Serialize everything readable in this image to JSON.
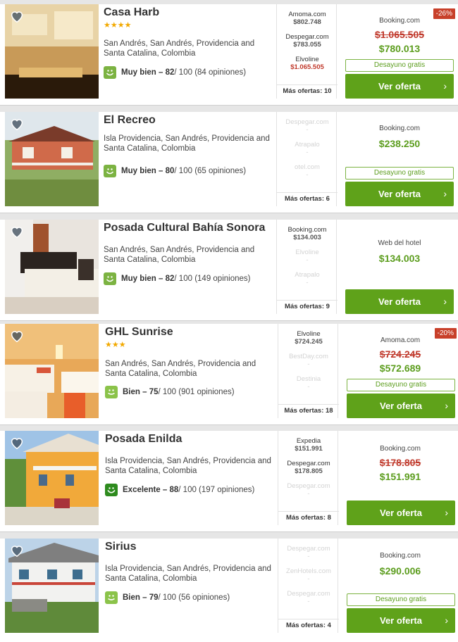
{
  "hotels": [
    {
      "name": "Casa Harb",
      "stars": "★★★★",
      "address": "San Andrés, San Andrés, Providencia and Santa Catalina, Colombia",
      "rating_label": "Muy bien – 82",
      "rating_rest": " / 100 (84 opiniones)",
      "rating_color": "#7cb342",
      "offers": [
        {
          "site": "Amoma.com",
          "price": "$802.748"
        },
        {
          "site": "Despegar.com",
          "price": "$783.055"
        },
        {
          "site": "Elvoline",
          "price": "$1.065.505"
        }
      ],
      "more_offers": "Más ofertas: 10",
      "discount": "-26%",
      "provider": "Booking.com",
      "old_price": "$1.065.505",
      "price": "$780.013",
      "breakfast": "Desayuno gratis",
      "button": "Ver oferta"
    },
    {
      "name": "El Recreo",
      "address": "Isla Providencia, San Andrés, Providencia and Santa Catalina, Colombia",
      "rating_label": "Muy bien – 80",
      "rating_rest": " / 100 (65 opiniones)",
      "rating_color": "#7cb342",
      "offers": [
        {
          "site": "Despegar.com",
          "price": "-"
        },
        {
          "site": "Atrapalo",
          "price": "-"
        },
        {
          "site": "otel.com",
          "price": "-"
        }
      ],
      "more_offers": "Más ofertas: 6",
      "provider": "Booking.com",
      "price": "$238.250",
      "breakfast": "Desayuno gratis",
      "button": "Ver oferta"
    },
    {
      "name": "Posada Cultural Bahía Sonora",
      "address": "San Andrés, San Andrés, Providencia and Santa Catalina, Colombia",
      "rating_label": "Muy bien – 82",
      "rating_rest": " / 100 (149 opiniones)",
      "rating_color": "#7cb342",
      "offers": [
        {
          "site": "Booking.com",
          "price": "$134.003"
        },
        {
          "site": "Elvoline",
          "price": "-"
        },
        {
          "site": "Atrapalo",
          "price": "-"
        }
      ],
      "more_offers": "Más ofertas: 9",
      "provider": "Web del hotel",
      "price": "$134.003",
      "button": "Ver oferta"
    },
    {
      "name": "GHL Sunrise",
      "stars": "★★★",
      "address": "San Andrés, San Andrés, Providencia and Santa Catalina, Colombia",
      "rating_label": "Bien – 75",
      "rating_rest": " / 100 (901 opiniones)",
      "rating_color": "#8bc34a",
      "offers": [
        {
          "site": "Elvoline",
          "price": "$724.245"
        },
        {
          "site": "BestDay.com",
          "price": "-"
        },
        {
          "site": "Destinia",
          "price": "-"
        }
      ],
      "more_offers": "Más ofertas: 18",
      "discount": "-20%",
      "provider": "Amoma.com",
      "old_price": "$724.245",
      "price": "$572.689",
      "breakfast": "Desayuno gratis",
      "button": "Ver oferta"
    },
    {
      "name": "Posada Enilda",
      "address": "Isla Providencia, San Andrés, Providencia and Santa Catalina, Colombia",
      "rating_label": "Excelente – 88",
      "rating_rest": " / 100 (197 opiniones)",
      "rating_color": "#2e8b1e",
      "offers": [
        {
          "site": "Expedia",
          "price": "$151.991"
        },
        {
          "site": "Despegar.com",
          "price": "$178.805"
        },
        {
          "site": "Despegar.com",
          "price": "-"
        }
      ],
      "more_offers": "Más ofertas: 8",
      "provider": "Booking.com",
      "old_price": "$178.805",
      "price": "$151.991",
      "button": "Ver oferta"
    },
    {
      "name": "Sirius",
      "address": "Isla Providencia, San Andrés, Providencia and Santa Catalina, Colombia",
      "rating_label": "Bien – 79",
      "rating_rest": " / 100 (56 opiniones)",
      "rating_color": "#8bc34a",
      "offers": [
        {
          "site": "Despegar.com",
          "price": "-"
        },
        {
          "site": "ZenHotels.com",
          "price": "-"
        },
        {
          "site": "Despegar.com",
          "price": "-"
        }
      ],
      "more_offers": "Más ofertas: 4",
      "provider": "Booking.com",
      "price": "$290.006",
      "breakfast": "Desayuno gratis",
      "button": "Ver oferta"
    }
  ],
  "icons": {
    "favorite": "heart-icon",
    "rating": "smiley-icon",
    "button": "chevron-right-icon"
  },
  "colors": {
    "accent_green": "#5fa21a",
    "discount_red": "#c8402a"
  }
}
